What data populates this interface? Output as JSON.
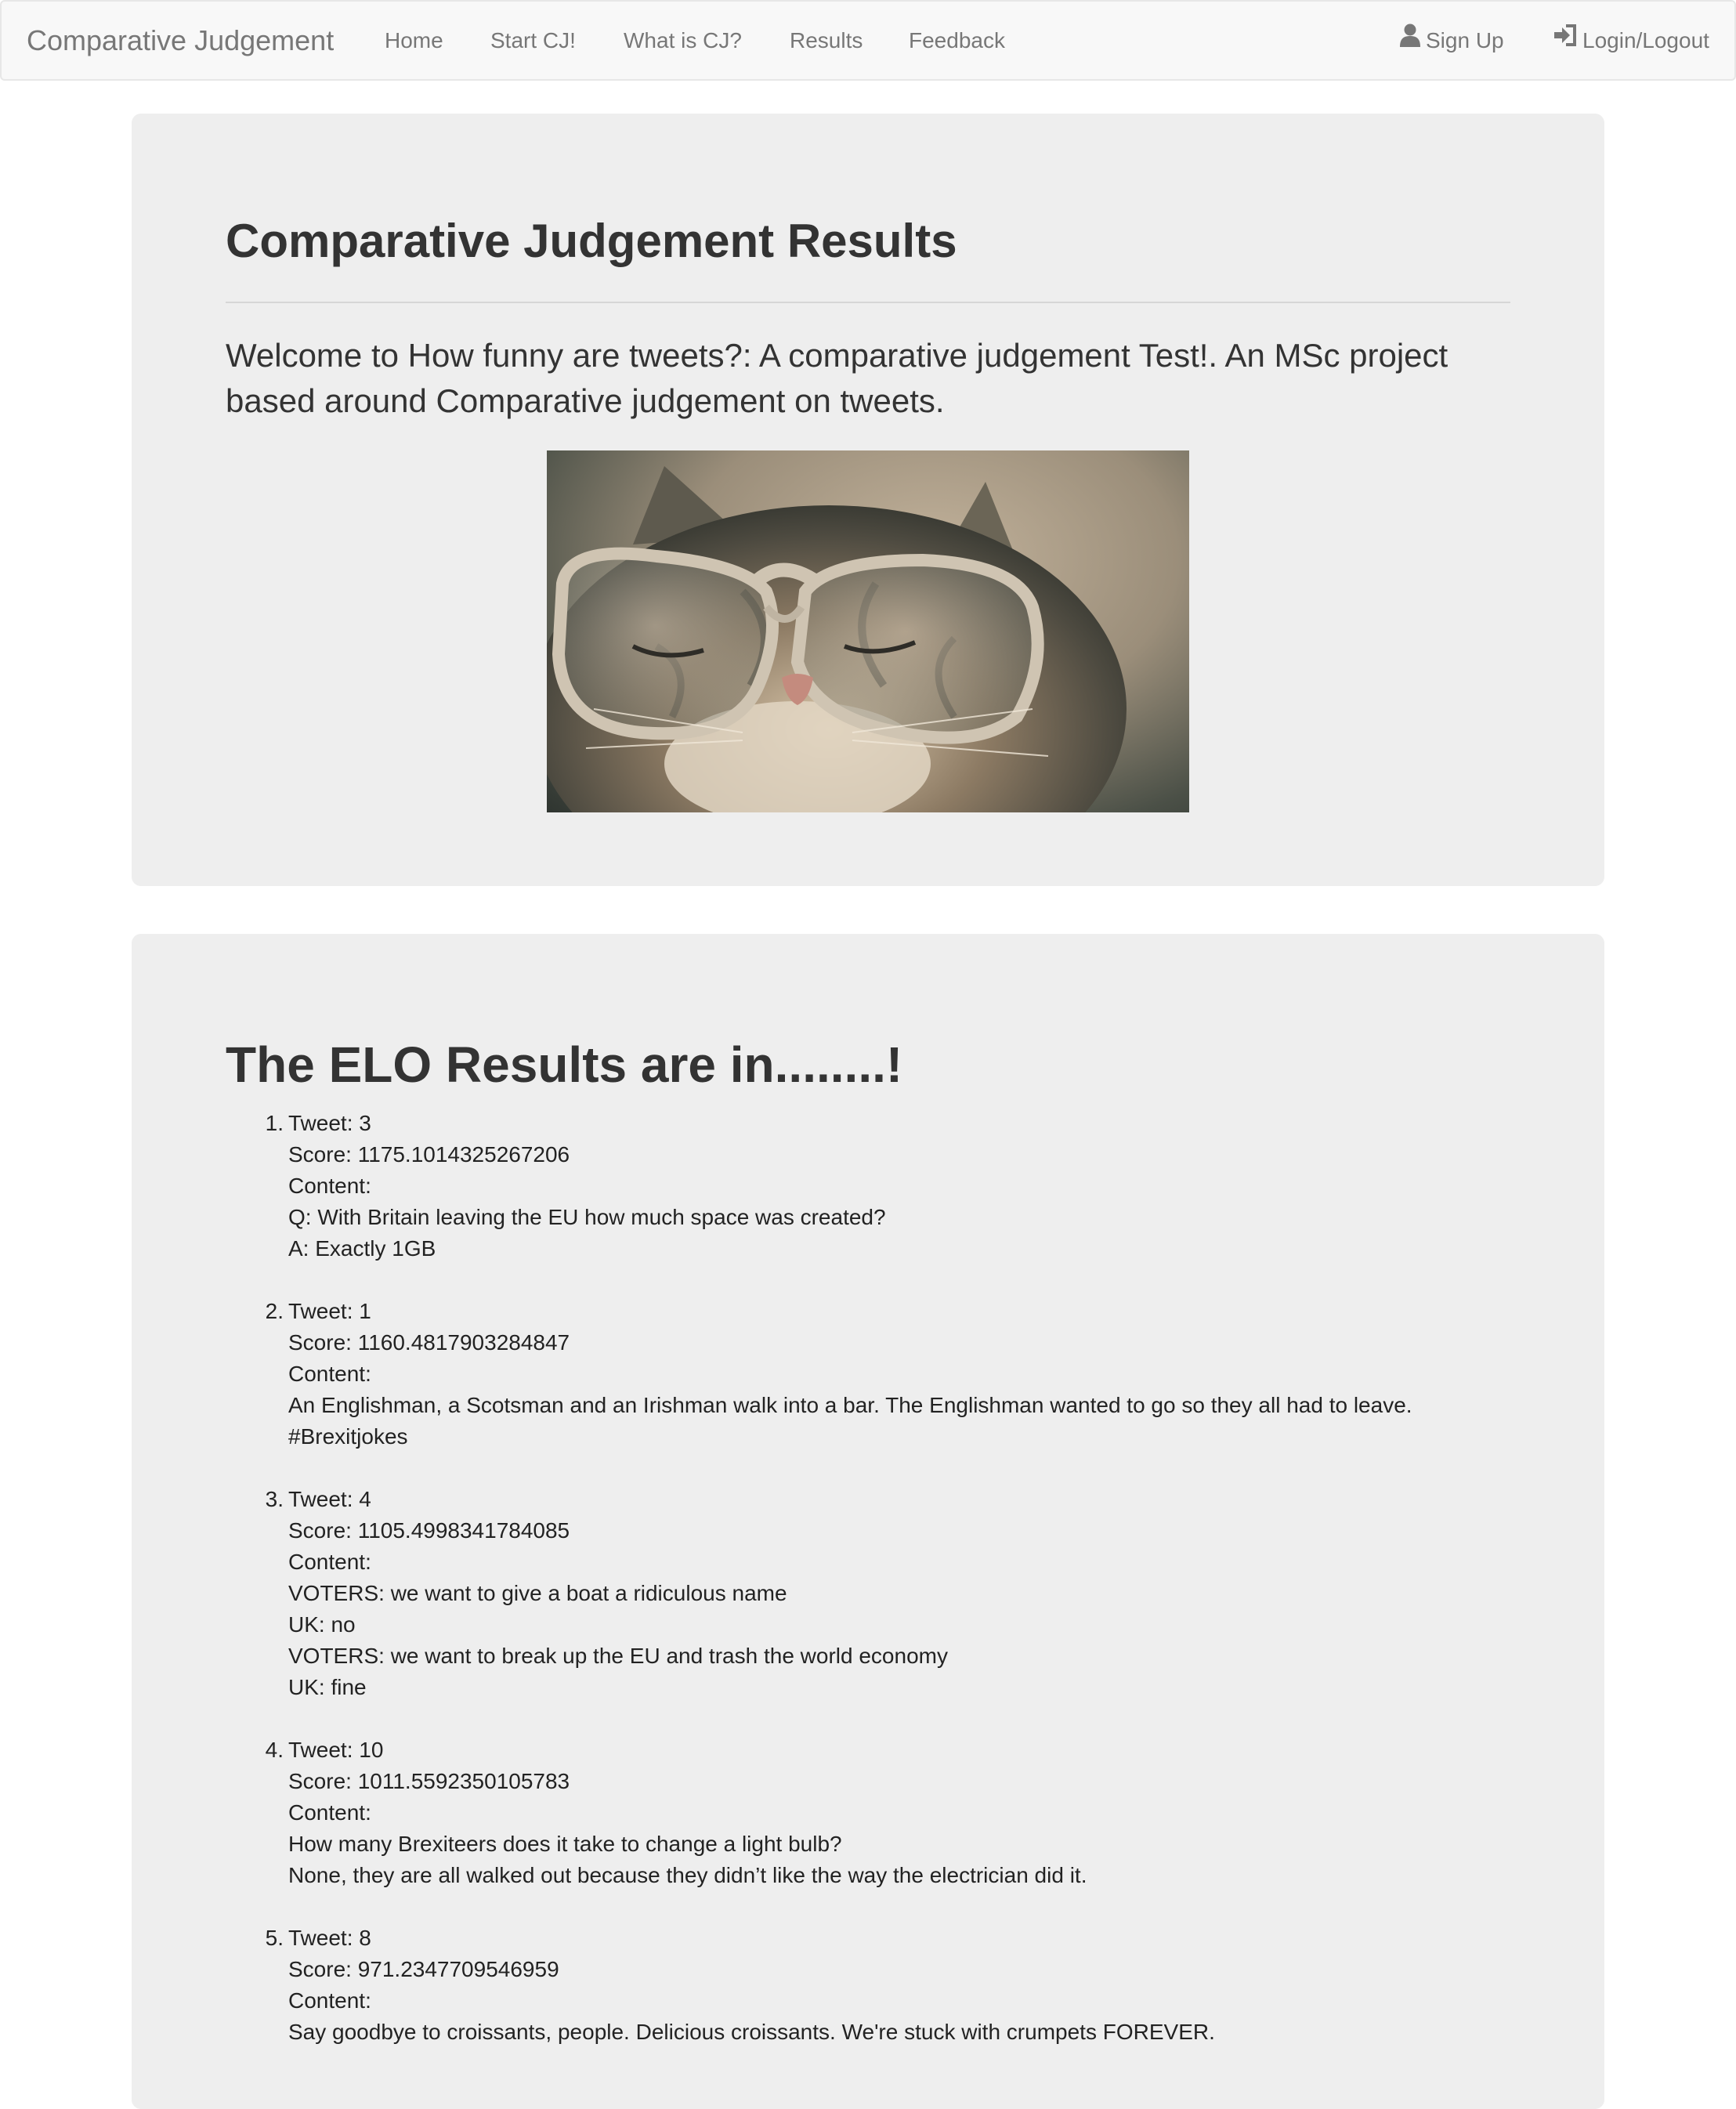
{
  "navbar": {
    "brand": "Comparative Judgement",
    "links": [
      "Home",
      "Start CJ!",
      "What is CJ?",
      "Results",
      "Feedback"
    ],
    "right": {
      "signup": "Sign Up",
      "login": "Login/Logout",
      "signup_icon": "user-icon",
      "login_icon": "log-in-icon"
    }
  },
  "header": {
    "title": "Comparative Judgement Results",
    "lead": "Welcome to How funny are tweets?: A comparative judgement Test!. An MSc project based around Comparative judgement on tweets."
  },
  "results": {
    "title": "The ELO Results are in........!",
    "items": [
      {
        "rank": "1.",
        "tweet": "Tweet: 3",
        "score": "Score: 1175.1014325267206",
        "content_label": "Content:",
        "content": [
          "Q: With Britain leaving the EU how much space was created?",
          "A: Exactly 1GB"
        ]
      },
      {
        "rank": "2.",
        "tweet": "Tweet: 1",
        "score": "Score: 1160.4817903284847",
        "content_label": "Content:",
        "content": [
          "An Englishman, a Scotsman and an Irishman walk into a bar. The Englishman wanted to go so they all had to leave.",
          "#Brexitjokes"
        ]
      },
      {
        "rank": "3.",
        "tweet": "Tweet: 4",
        "score": "Score: 1105.4998341784085",
        "content_label": "Content:",
        "content": [
          "VOTERS: we want to give a boat a ridiculous name",
          "UK: no",
          "VOTERS: we want to break up the EU and trash the world economy",
          "UK: fine"
        ]
      },
      {
        "rank": "4.",
        "tweet": "Tweet: 10",
        "score": "Score: 1011.5592350105783",
        "content_label": "Content:",
        "content": [
          "How many Brexiteers does it take to change a light bulb?",
          "None, they are all walked out because they didn’t like the way the electrician did it."
        ]
      },
      {
        "rank": "5.",
        "tweet": "Tweet: 8",
        "score": "Score: 971.2347709546959",
        "content_label": "Content:",
        "content": [
          "Say goodbye to croissants, people. Delicious croissants. We're stuck with crumpets FOREVER."
        ]
      }
    ]
  }
}
